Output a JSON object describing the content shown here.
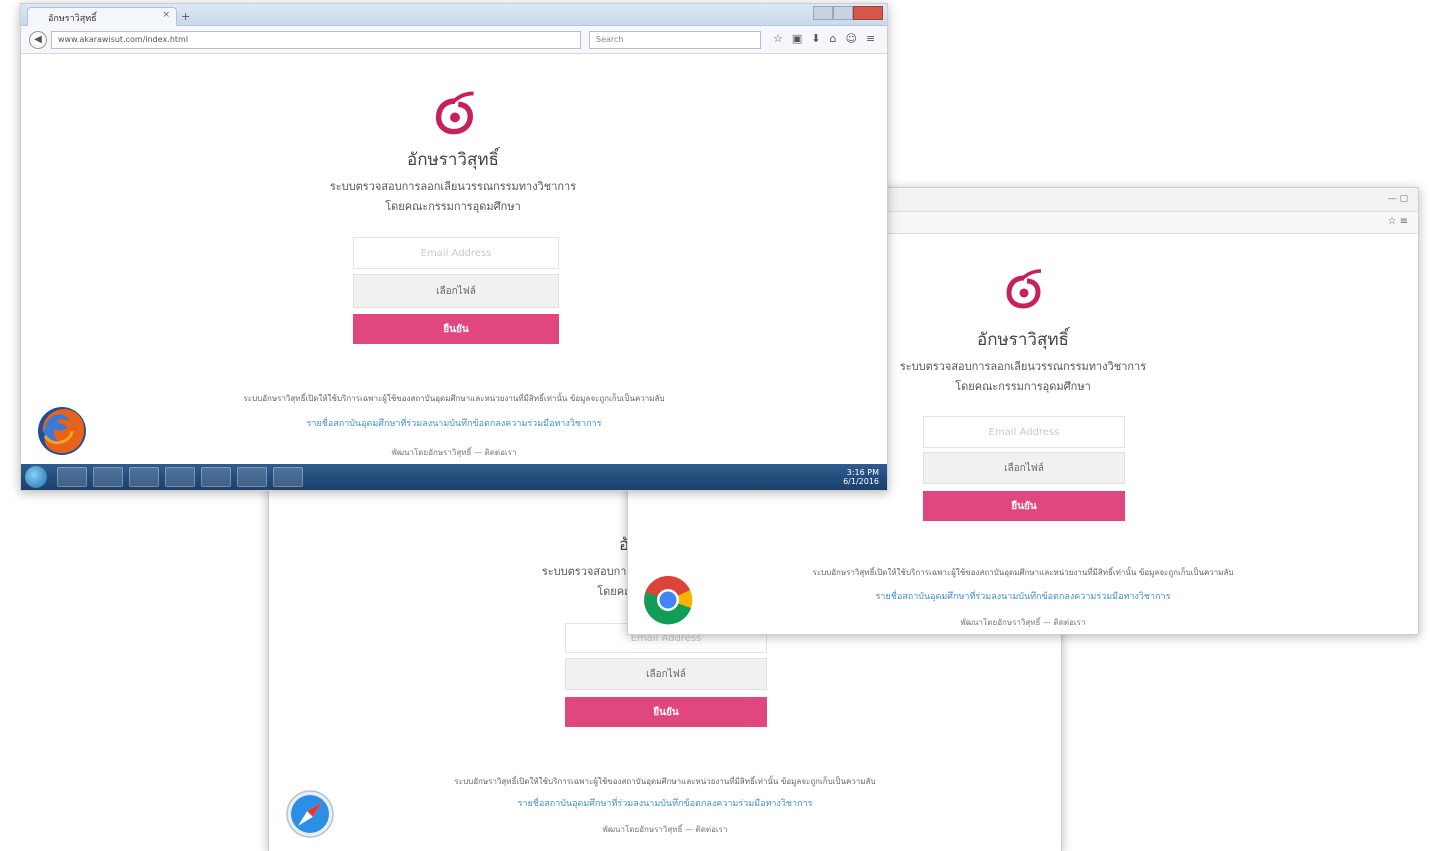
{
  "site": {
    "brand": "อักษราวิสุทธิ์",
    "subtitle_line1": "ระบบตรวจสอบการลอกเลียนวรรณกรรมทางวิชาการ",
    "subtitle_line2": "โดยคณะกรรมการอุดมศึกษา",
    "email_placeholder": "Email Address",
    "choose_file_label": "เลือกไฟล์",
    "submit_label": "ยืนยัน",
    "notice_text": "ระบบอักษราวิสุทธิ์เปิดให้ใช้บริการเฉพาะผู้ใช้ของสถาบันอุดมศึกษาและหน่วยงานที่มีสิทธิ์เท่านั้น ข้อมูลจะถูกเก็บเป็นความลับ",
    "link_text": "รายชื่อสถาบันอุดมศึกษาที่ร่วมลงนามบันทึกข้อตกลงความร่วมมือทางวิชาการ",
    "credit_text": "พัฒนาโดยอักษราวิสุทธิ์ — ติดต่อเรา"
  },
  "firefox": {
    "tab_title": "อักษราวิสุทธิ์",
    "tab_close": "×",
    "new_tab": "+",
    "back_glyph": "◀",
    "url": "www.akarawisut.com/index.html",
    "search_placeholder": "Search",
    "toolbar_icons": [
      "star-icon",
      "bookmark-icon",
      "download-icon",
      "home-icon",
      "settings-icon",
      "menu-icon"
    ],
    "toolbar_glyphs": [
      "☆",
      "▣",
      "⬇",
      "⌂",
      "☺",
      "≡"
    ],
    "clock_time": "3:16 PM",
    "clock_date": "6/1/2016"
  },
  "chrome": {
    "window_controls": "— ▢",
    "menu_glyph": "☆ ≡"
  },
  "colors": {
    "accent_pink": "#e0477f",
    "logo_pink": "#c8205a",
    "link_blue": "#3f8fd0"
  }
}
